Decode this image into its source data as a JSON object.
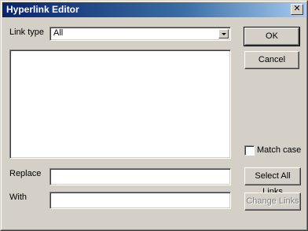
{
  "window": {
    "title": "Hyperlink Editor",
    "close_glyph": "✕"
  },
  "link_type": {
    "label": "Link type",
    "value": "All"
  },
  "match_case": {
    "label": "Match case",
    "checked": false
  },
  "replace": {
    "label": "Replace",
    "value": ""
  },
  "with": {
    "label": "With",
    "value": ""
  },
  "buttons": {
    "ok": "OK",
    "cancel": "Cancel",
    "select_all": "Select All Links",
    "change": "Change Links"
  },
  "icons": {
    "close": "close-icon",
    "dropdown": "chevron-down-icon"
  }
}
